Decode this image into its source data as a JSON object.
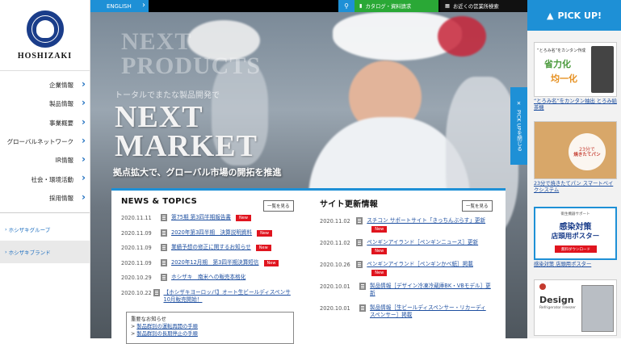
{
  "brand": {
    "name": "HOSHIZAKI"
  },
  "sidebar": {
    "items": [
      {
        "label": "企業情報"
      },
      {
        "label": "製品情報"
      },
      {
        "label": "事業概要"
      },
      {
        "label": "グローバルネットワーク"
      },
      {
        "label": "IR情報"
      },
      {
        "label": "社会・環境活動"
      },
      {
        "label": "採用情報"
      }
    ],
    "links": [
      {
        "label": "ホシザキグループ"
      },
      {
        "label": "ホシザキブランド"
      }
    ]
  },
  "topbar": {
    "lang": "ENGLISH",
    "catalog": "カタログ・資料請求",
    "office": "お近くの営業所検索"
  },
  "hero": {
    "ghost_text": "NEXT PRODUCTS",
    "subtitle": "トータルでまたな製品開発で",
    "title_line1": "NEXT",
    "title_line2": "MARKET",
    "tagline": "拠点拡大で、グローバル市場の開拓を推進",
    "pickup_tab": "PICK UPを閉じる"
  },
  "news": {
    "heading": "NEWS & TOPICS",
    "more": "一覧を見る",
    "new_label": "New",
    "items": [
      {
        "date": "2020.11.11",
        "title": "第75期 第3四半期報告書",
        "is_new": true
      },
      {
        "date": "2020.11.09",
        "title": "2020年第3四半期　決算説明資料",
        "is_new": true
      },
      {
        "date": "2020.11.09",
        "title": "業績予想の修正に関するお知らせ",
        "is_new": true
      },
      {
        "date": "2020.11.09",
        "title": "2020年12月期　第3四半期決算短信",
        "is_new": true
      },
      {
        "date": "2020.10.29",
        "title": "ホシザキ　南米への販売本格化",
        "is_new": false
      },
      {
        "date": "2020.10.22",
        "title": "【ホシザキヨーロッパ】オート生ビールディスペンサ10月販売開始！",
        "is_new": false
      }
    ],
    "notice_heading": "重要なお知らせ",
    "notice_links": [
      "製品群別の運転再開の手順",
      "製品群別の長期停止の手順"
    ]
  },
  "site_updates": {
    "heading": "サイト更新情報",
    "more": "一覧を見る",
    "new_label": "New",
    "items": [
      {
        "date": "2020.11.02",
        "title": "スチコン サポートサイト「きっちんぶらす」更新",
        "is_new": true
      },
      {
        "date": "2020.11.02",
        "title": "ペンギンアイランド［ペンギンニュース］更新",
        "is_new": true
      },
      {
        "date": "2020.10.26",
        "title": "ペンギンアイランド［ペンギンかべ紙］掲載",
        "is_new": true
      },
      {
        "date": "2020.10.01",
        "title": "製品情報［デザイン冷凍冷蔵庫BK・VBモデル］更新",
        "is_new": false
      },
      {
        "date": "2020.10.01",
        "title": "製品情報［生ビールディスペンサー・リカーディスペンサー］掲載",
        "is_new": false
      }
    ]
  },
  "pickup": {
    "heading": "PICK UP!",
    "cards": [
      {
        "img_line1": "“とろみ名”をカンタン作成",
        "img_big": "省力化",
        "img_big2": "均一化",
        "caption": "“とろみ名”をカンタン抽出 とろみ給茶機"
      },
      {
        "img_line1": "23分で",
        "img_big": "焼きたてパン",
        "caption": "23分で焼きたてパン スマートベイクシステム"
      },
      {
        "img_line1": "衛生機器サポート",
        "img_big": "感染対策",
        "img_big2": "店頭用ポスター",
        "img_btn": "無料ダウンロード",
        "caption": "感染対策 店頭用ポスター"
      },
      {
        "img_big": "Design",
        "img_line1": "Refrigerator Freezer"
      }
    ]
  },
  "colors": {
    "accent": "#1e90d6",
    "green": "#2aa836",
    "new_badge": "#e0141e"
  }
}
